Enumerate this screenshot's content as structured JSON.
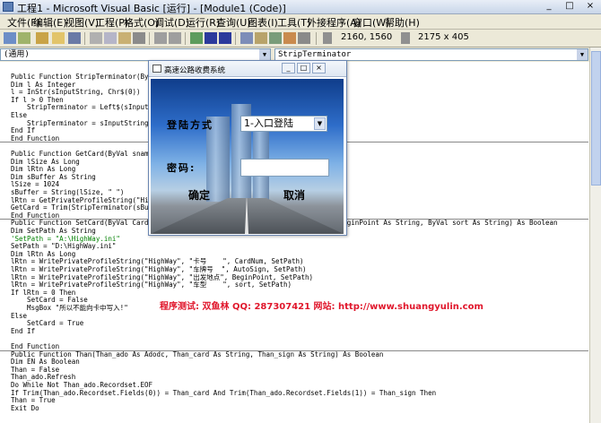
{
  "window": {
    "title": "工程1 - Microsoft Visual Basic [运行] - [Module1 (Code)]",
    "controls": [
      "_",
      "□",
      "×"
    ]
  },
  "menubar": [
    "文件(F)",
    "编辑(E)",
    "视图(V)",
    "工程(P)",
    "格式(O)",
    "调试(D)",
    "运行(R)",
    "查询(U)",
    "图表(I)",
    "工具(T)",
    "外接程序(A)",
    "窗口(W)",
    "帮助(H)"
  ],
  "toolbar": {
    "position": "2160, 1560",
    "size": "2175 x 405"
  },
  "code_window": {
    "object_combo": "(通用)",
    "procedure_combo": "StripTerminator",
    "lines": [
      "Public Function StripTerminator(ByVal sInputString As String) As String",
      "Dim l As Integer",
      "l = InStr(sInputString, Chr$(0))",
      "If l > 0 Then",
      "    StripTerminator = Left$(sInputString, l - 1)",
      "Else",
      "    StripTerminator = sInputString",
      "End If",
      "End Function",
      "",
      "Public Function GetCard(ByVal sname As String) As String",
      "Dim lSize As Long",
      "Dim lRtn As Long",
      "Dim sBuffer As String",
      "lSize = 1024",
      "sBuffer = String(lSize, \" \")",
      "lRtn = GetPrivateProfileString(\"HighWay\", sname, \"\", sBuffer, lSize, SetPath)",
      "GetCard = Trim(StripTerminator(sBuffer))",
      "End Function",
      "Public Function SetCard(ByVal CardNum As String, ByVal AutoSign As String, ByVal BeginPoint As String, ByVal sort As String) As Boolean",
      "Dim SetPath As String",
      "'SetPath = \"A:\\HighWay.ini\"",
      "SetPath = \"D:\\HighWay.ini\"",
      "Dim lRtn As Long",
      "lRtn = WritePrivateProfileString(\"HighWay\", \"卡号    \", CardNum, SetPath)",
      "lRtn = WritePrivateProfileString(\"HighWay\", \"车牌号  \", AutoSign, SetPath)",
      "lRtn = WritePrivateProfileString(\"HighWay\", \"出发地点\", BeginPoint, SetPath)",
      "lRtn = WritePrivateProfileString(\"HighWay\", \"车型    \", sort, SetPath)",
      "If lRtn = 0 Then",
      "    SetCard = False",
      "    MsgBox \"所以不能向卡中写入!\"",
      "Else",
      "    SetCard = True",
      "End If",
      "",
      "End Function",
      "Public Function Than(Than_ado As Adodc, Than_card As String, Than_sign As String) As Boolean",
      "Dim EN As Boolean",
      "Than = False",
      "Than_ado.Refresh",
      "Do While Not Than_ado.Recordset.EOF",
      "If Trim(Than_ado.Recordset.Fields(0)) = Than_card And Trim(Than_ado.Recordset.Fields(1)) = Than_sign Then",
      "Than = True",
      "Exit Do"
    ]
  },
  "watermark": "程序测试: 双鱼林  QQ: 287307421  网站: http://www.shuangyulin.com",
  "dialog": {
    "title": "高速公路收费系统",
    "controls": [
      "_",
      "□",
      "×"
    ],
    "login_label": "登陆方式",
    "login_value": "1-入口登陆",
    "password_label": "密码:",
    "password_value": "",
    "ok_label": "确定",
    "cancel_label": "取消"
  }
}
